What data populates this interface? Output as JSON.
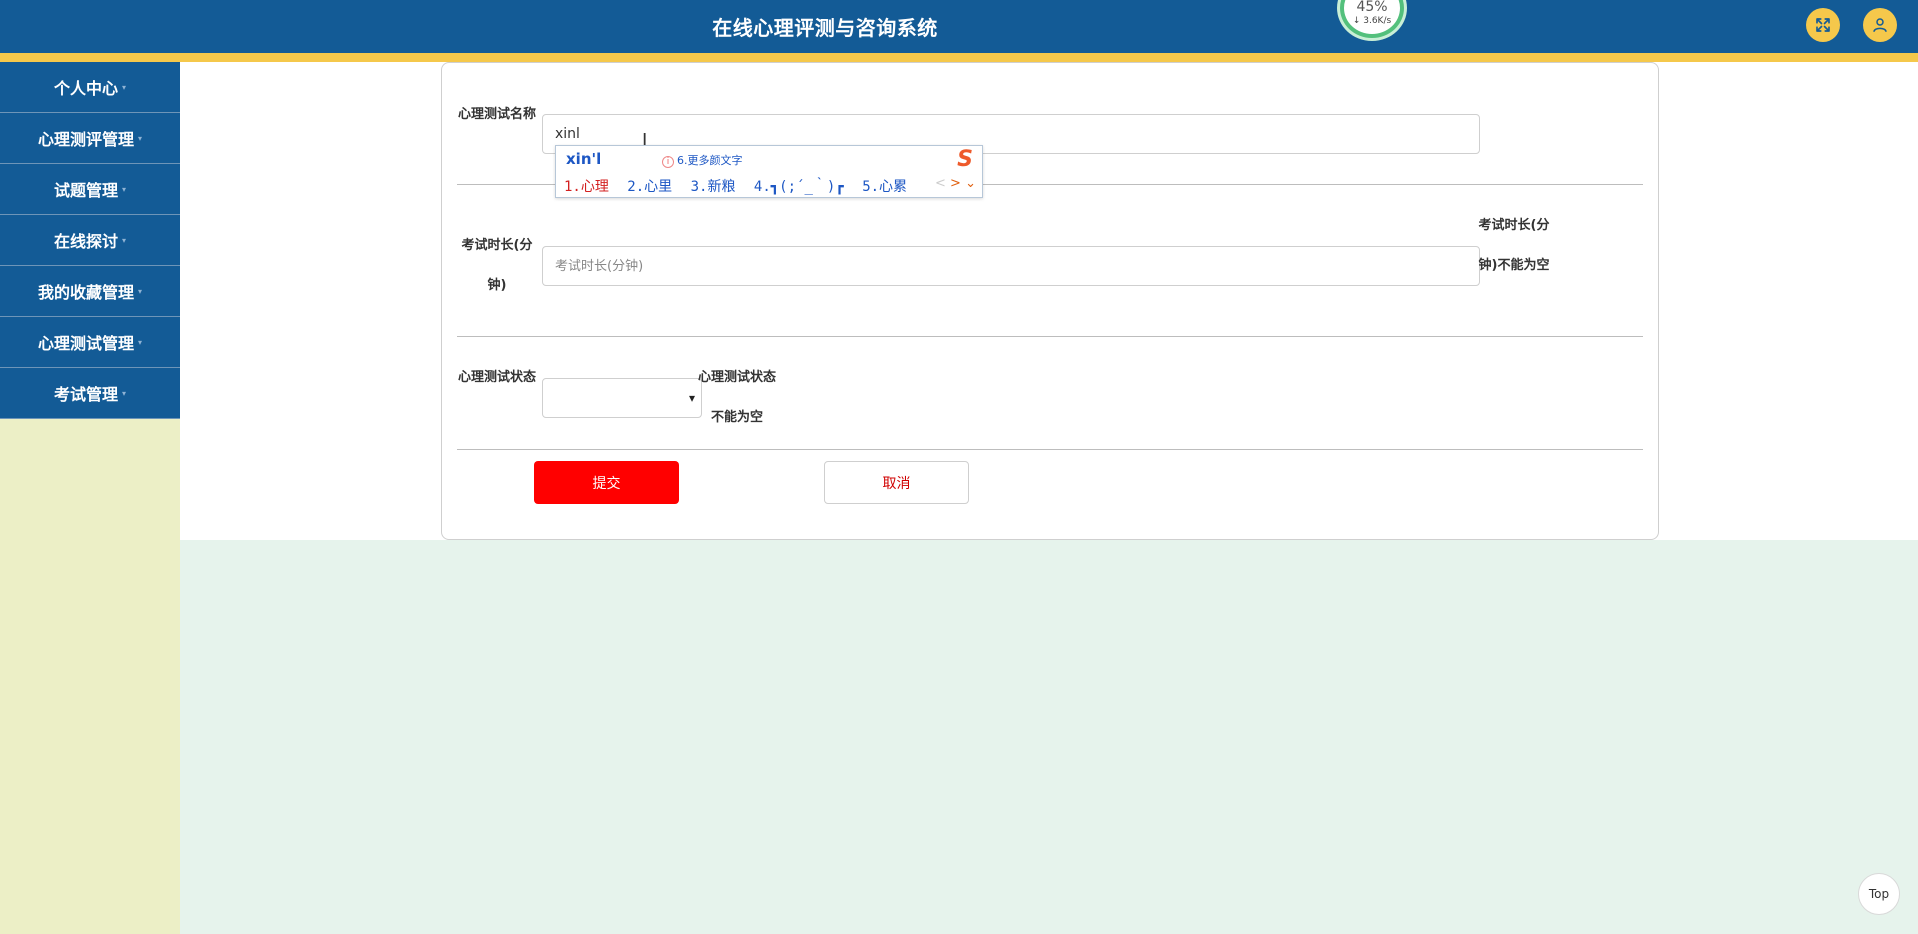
{
  "header": {
    "title": "在线心理评测与咨询系统",
    "network_widget": {
      "percent": "45%",
      "speed": "↓ 3.6K/s"
    },
    "expand_icon": "expand-icon",
    "user_icon": "user-icon"
  },
  "sidebar": {
    "items": [
      {
        "label": "个人中心"
      },
      {
        "label": "心理测评管理"
      },
      {
        "label": "试题管理"
      },
      {
        "label": "在线探讨"
      },
      {
        "label": "我的收藏管理"
      },
      {
        "label": "心理测试管理"
      },
      {
        "label": "考试管理"
      }
    ],
    "caret": "▾"
  },
  "form": {
    "name_label": "心理测试名称",
    "name_value": "xinl",
    "duration_label": "考试时长(分钟)",
    "duration_placeholder": "考试时长(分钟)",
    "duration_error": "考试时长(分钟)不能为空",
    "status_label": "心理测试状态",
    "status_error": "心理测试状态不能为空",
    "submit_label": "提交",
    "cancel_label": "取消"
  },
  "ime": {
    "pinyin": "xin'l",
    "tip_number": "6.",
    "tip_text": "更多颜文字",
    "logo": "S",
    "candidates": [
      "1.心理",
      "2.心里",
      "3.新粮",
      "4.┓(;´_｀)┏",
      "5.心累"
    ],
    "prev_arrow": "<",
    "next_arrow": ">",
    "expand_arrow": "⌄"
  },
  "top_button": "Top",
  "colors": {
    "header_bg": "#135b96",
    "header_stripe": "#f5c84b",
    "sidebar_bg": "#ecefc6",
    "page_bg": "#e6f3ec",
    "submit_bg": "#ff0000"
  }
}
